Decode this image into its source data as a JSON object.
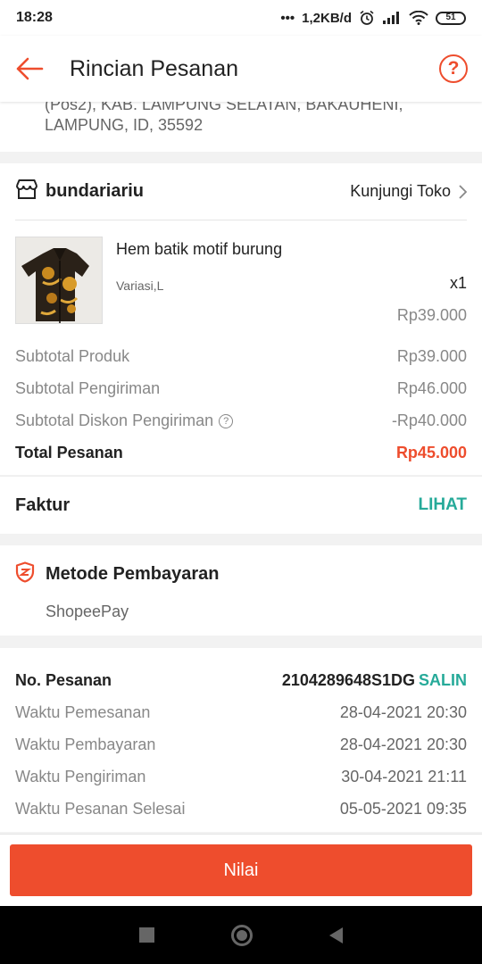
{
  "status_bar": {
    "time": "18:28",
    "dots": "•••",
    "speed": "1,2KB/d",
    "battery": "51"
  },
  "header": {
    "title": "Rincian Pesanan",
    "help_icon": "help-circle-icon"
  },
  "address": {
    "line1": "(Pos2), KAB. LAMPUNG SELATAN, BAKAUHENI,",
    "line2": "LAMPUNG, ID, 35592"
  },
  "shop": {
    "name": "bundariariu",
    "visit_label": "Kunjungi Toko",
    "product": {
      "name": "Hem batik motif burung",
      "variation": "Variasi,L",
      "quantity": "x1",
      "price": "Rp39.000"
    },
    "summary": [
      {
        "label": "Subtotal Produk",
        "value": "Rp39.000"
      },
      {
        "label": "Subtotal Pengiriman",
        "value": "Rp46.000"
      },
      {
        "label": "Subtotal Diskon Pengiriman",
        "value": "-Rp40.000"
      }
    ],
    "total": {
      "label": "Total Pesanan",
      "value": "Rp45.000"
    }
  },
  "invoice": {
    "label": "Faktur",
    "link": "LIHAT"
  },
  "payment": {
    "title": "Metode Pembayaran",
    "method": "ShopeePay"
  },
  "order": {
    "number_label": "No. Pesanan",
    "number": "2104289648S1DG",
    "copy_label": "SALIN",
    "times": [
      {
        "label": "Waktu Pemesanan",
        "value": "28-04-2021 20:30"
      },
      {
        "label": "Waktu Pembayaran",
        "value": "28-04-2021 20:30"
      },
      {
        "label": "Waktu Pengiriman",
        "value": "30-04-2021 21:11"
      },
      {
        "label": "Waktu Pesanan Selesai",
        "value": "05-05-2021 09:35"
      }
    ]
  },
  "action": {
    "button": "Nilai"
  },
  "colors": {
    "accent": "#ee4d2d",
    "link": "#26aa99"
  }
}
